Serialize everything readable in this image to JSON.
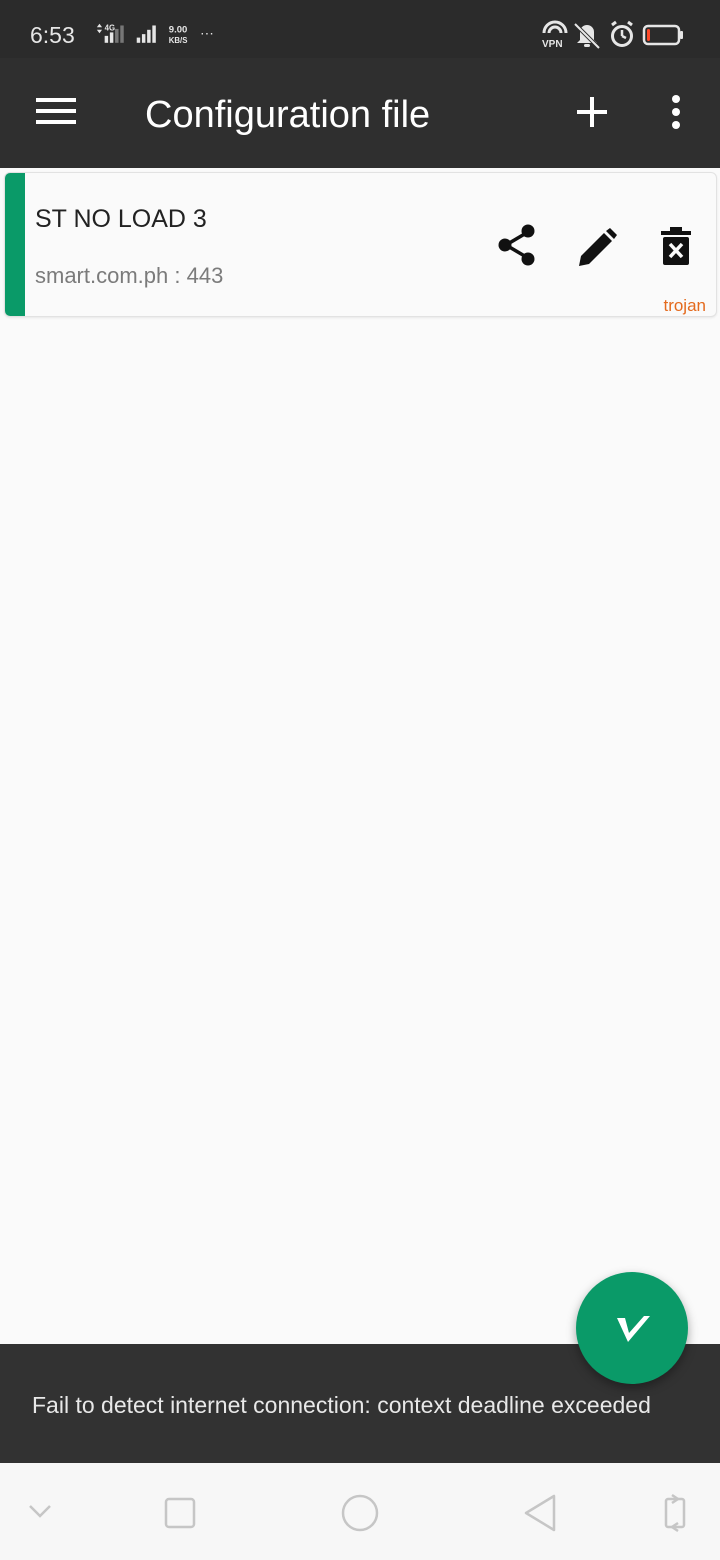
{
  "status_bar": {
    "time": "6:53",
    "network_type": "4G",
    "speed_value": "9.00",
    "speed_unit": "KB/S",
    "more_indicator": "···",
    "vpn_label": "VPN",
    "battery_level_percent": 10,
    "icons": [
      "data-transfer-icon",
      "signal-4g-icon",
      "signal-icon",
      "vpn-icon",
      "mute-icon",
      "alarm-icon",
      "battery-icon"
    ]
  },
  "app_bar": {
    "title": "Configuration file",
    "icons": [
      "menu-icon",
      "add-icon",
      "more-vert-icon"
    ]
  },
  "servers": [
    {
      "name": "ST NO LOAD 3",
      "host": "smart.com.ph",
      "separator": " : ",
      "port": "443",
      "protocol": "trojan",
      "actions": [
        "share-icon",
        "edit-icon",
        "delete-icon"
      ]
    }
  ],
  "snackbar": {
    "message": "Fail to detect internet connection:  context deadline exceeded"
  },
  "fab": {
    "icon": "v-logo-icon"
  },
  "nav_bar": {
    "icons": [
      "collapse-icon",
      "recents-icon",
      "home-icon",
      "back-icon",
      "rotate-icon"
    ]
  },
  "colors": {
    "accent": "#0a9a68",
    "app_bar": "#2f2f2f",
    "status_bar": "#2b2b2b",
    "protocol_label": "#e46a1d",
    "snackbar": "#323232",
    "battery_low": "#ff4a2a"
  }
}
